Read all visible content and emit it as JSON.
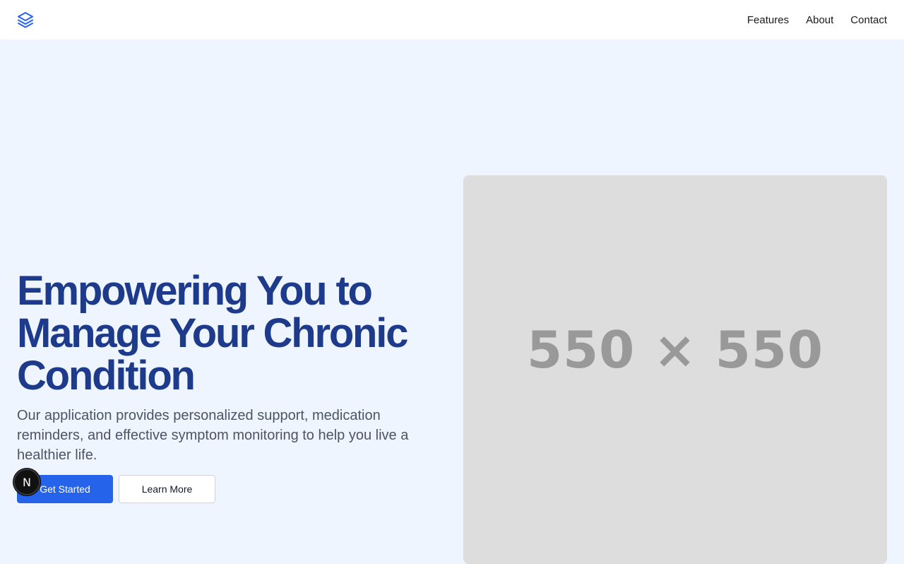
{
  "header": {
    "logo_icon": "layers-icon",
    "nav": [
      {
        "label": "Features"
      },
      {
        "label": "About"
      },
      {
        "label": "Contact"
      }
    ]
  },
  "hero": {
    "title": "Empowering You to Manage Your Chronic Condition",
    "description": "Our application provides personalized support, medication reminders, and effective symptom monitoring to help you live a healthier life.",
    "primary_button": "Get Started",
    "secondary_button": "Learn More",
    "image_placeholder": "550 × 550"
  },
  "dev_badge": {
    "label": "N",
    "icon": "nextjs-icon"
  },
  "colors": {
    "accent": "#2563eb",
    "title": "#1e3a8a",
    "background": "#eef5ff",
    "placeholder": "#dddddd"
  }
}
